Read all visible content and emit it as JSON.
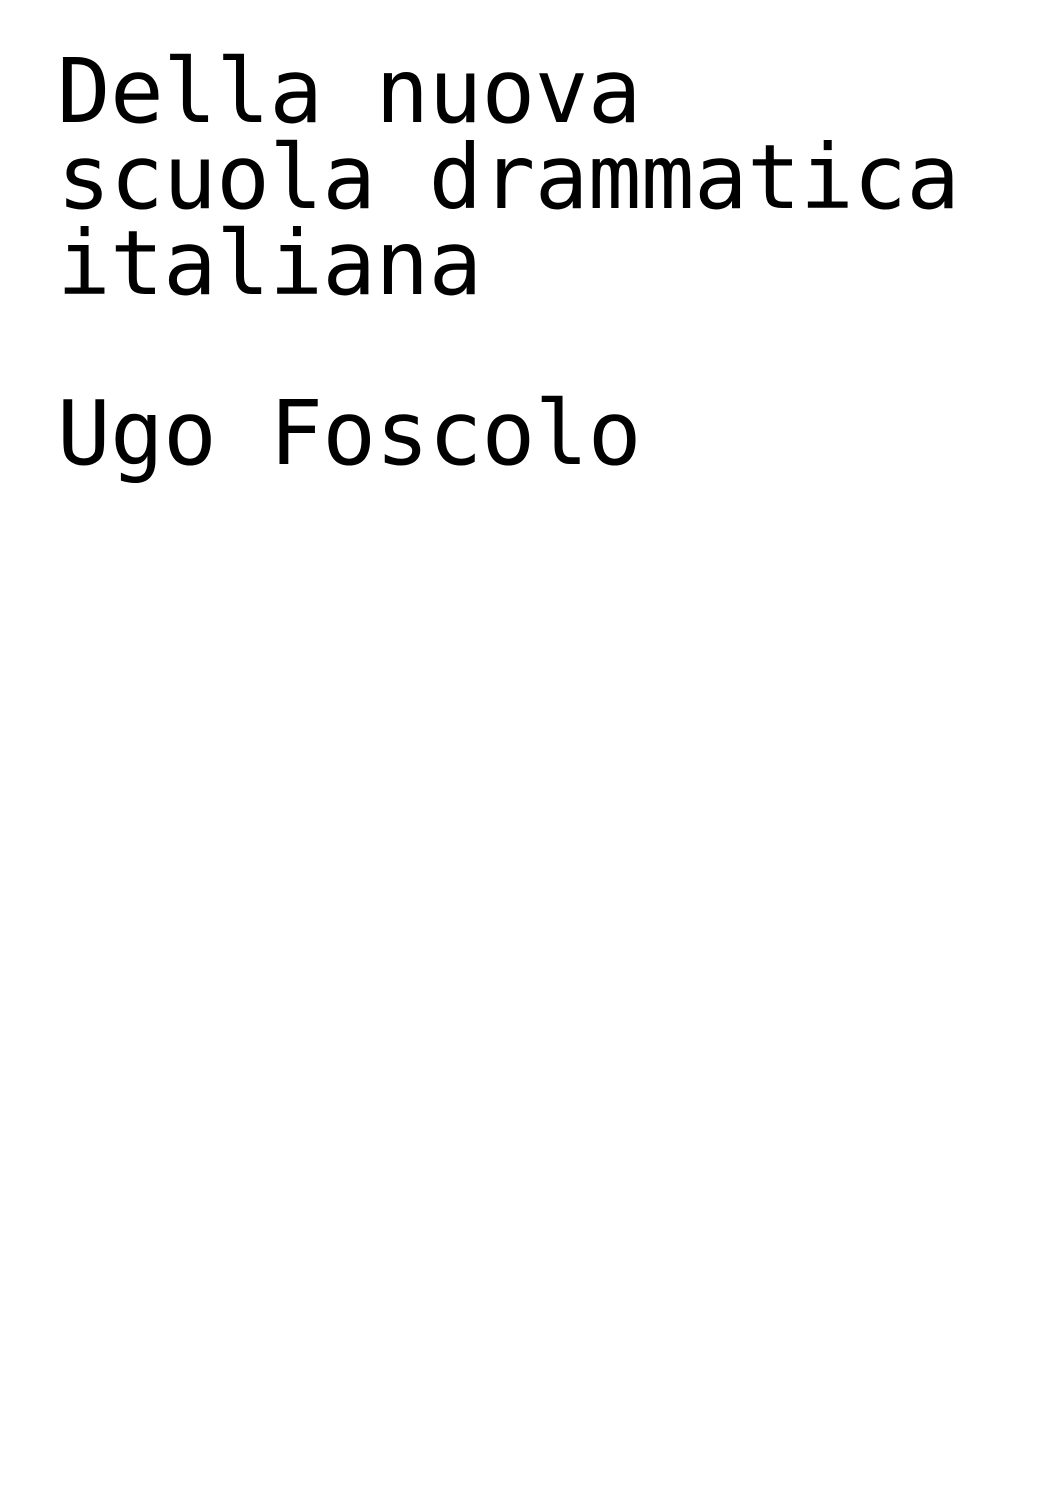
{
  "cover": {
    "title_lines": [
      "Della nuova",
      "scuola drammatica",
      "italiana"
    ],
    "author": "Ugo Foscolo"
  },
  "colors": {
    "background": "#ffffff",
    "text": "#000000"
  }
}
